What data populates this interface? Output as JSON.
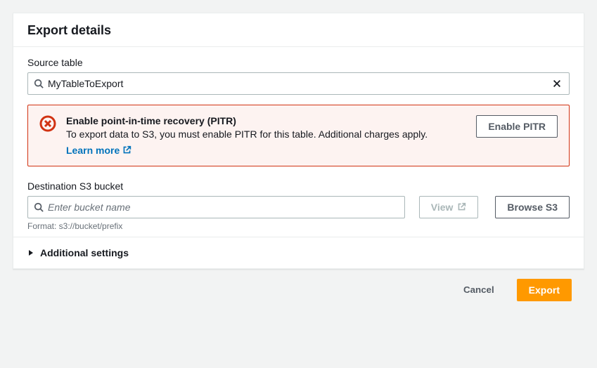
{
  "panel": {
    "title": "Export details"
  },
  "sourceTable": {
    "label": "Source table",
    "value": "MyTableToExport"
  },
  "alert": {
    "title": "Enable point-in-time recovery (PITR)",
    "description": "To export data to S3, you must enable PITR for this table. Additional charges apply.",
    "learnMoreLabel": "Learn more",
    "actionLabel": "Enable PITR"
  },
  "destination": {
    "label": "Destination S3 bucket",
    "placeholder": "Enter bucket name",
    "value": "",
    "viewLabel": "View",
    "browseLabel": "Browse S3",
    "hint": "Format: s3://bucket/prefix"
  },
  "additionalSettings": {
    "label": "Additional settings"
  },
  "footer": {
    "cancelLabel": "Cancel",
    "exportLabel": "Export"
  }
}
